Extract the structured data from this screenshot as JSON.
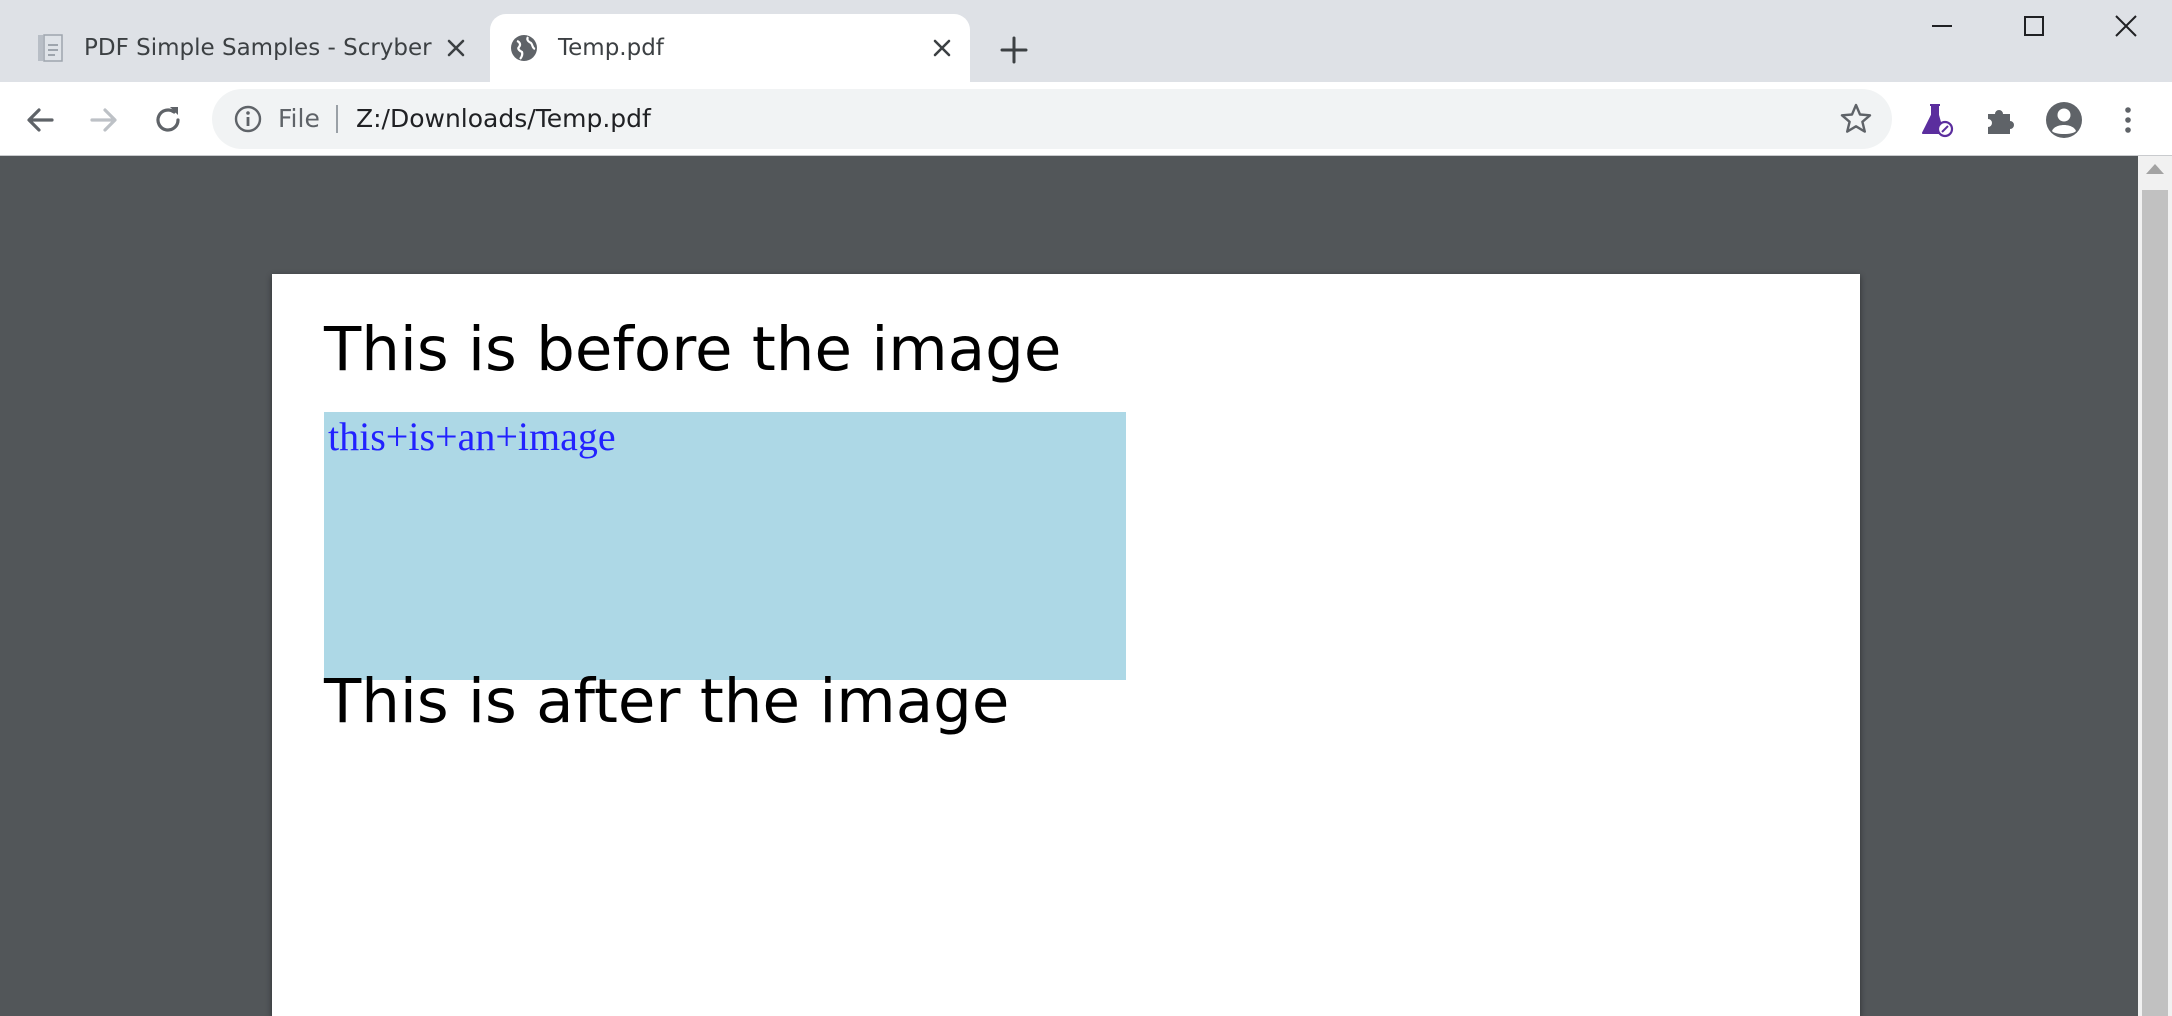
{
  "tabs": [
    {
      "title": "PDF Simple Samples - Scryber",
      "favicon": "document-icon",
      "active": false
    },
    {
      "title": "Temp.pdf",
      "favicon": "globe-icon",
      "active": true
    }
  ],
  "toolbar": {
    "scheme": "File",
    "url": "Z:/Downloads/Temp.pdf"
  },
  "document": {
    "before_text": "This is before the image",
    "image_alt": "this+is+an+image",
    "after_text": "This is after the image"
  },
  "colors": {
    "tabstrip": "#dee1e6",
    "viewer_bg": "#525659",
    "image_placeholder": "#add8e6",
    "alt_text": "#2222ff",
    "labs_icon": "#5b2e9e"
  }
}
